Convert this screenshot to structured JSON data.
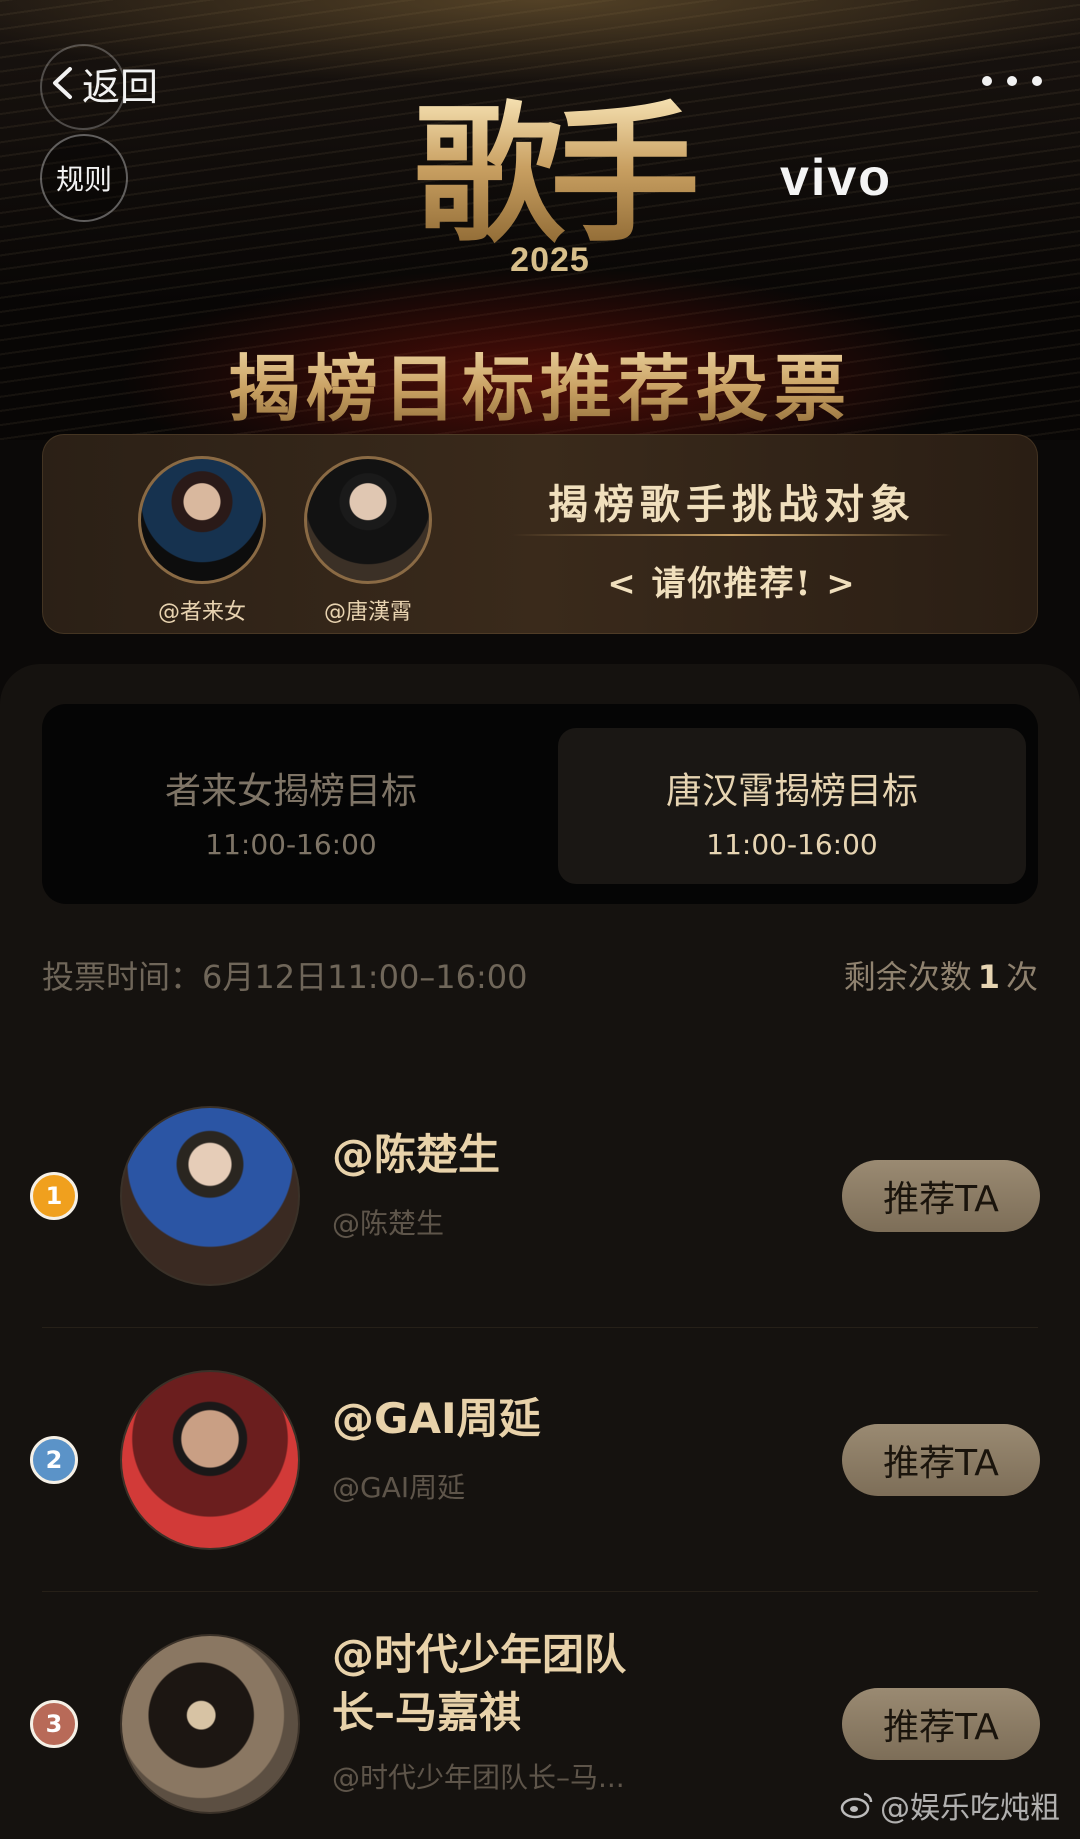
{
  "nav": {
    "back_label": "返回",
    "rules_label": "规则"
  },
  "banner": {
    "logo_text": "歌手",
    "logo_year": "2025",
    "brand": "vivo",
    "headline": "揭榜目标推荐投票"
  },
  "challenge": {
    "singers": [
      "@者来女",
      "@唐漢霄"
    ],
    "title": "揭榜歌手挑战对象",
    "subtitle": "< 请你推荐! >"
  },
  "tabs": [
    {
      "title": "者来女揭榜目标",
      "time": "11:00-16:00",
      "active": false
    },
    {
      "title": "唐汉霄揭榜目标",
      "time": "11:00-16:00",
      "active": true
    }
  ],
  "vote": {
    "time_label": "投票时间：6月12日11:00–16:00",
    "remaining_prefix": "剩余次数",
    "remaining_count": "1",
    "remaining_suffix": "次"
  },
  "candidates": [
    {
      "rank": "1",
      "name": "@陈楚生",
      "handle": "@陈楚生",
      "button": "推荐TA"
    },
    {
      "rank": "2",
      "name": "@GAI周延",
      "handle": "@GAI周延",
      "button": "推荐TA"
    },
    {
      "rank": "3",
      "name": "@时代少年团队长–马嘉祺",
      "name_line1": "@时代少年团队",
      "name_line2": "长–马嘉祺",
      "handle": "@时代少年团队长–马...",
      "button": "推荐TA"
    }
  ],
  "watermark": "@娱乐吃炖粗",
  "colors": {
    "gold": "#e8d2aa",
    "button_bg": "#9a8a72",
    "rank1": "#f0a01e",
    "rank2": "#5b93c8",
    "rank3": "#b86a58"
  }
}
